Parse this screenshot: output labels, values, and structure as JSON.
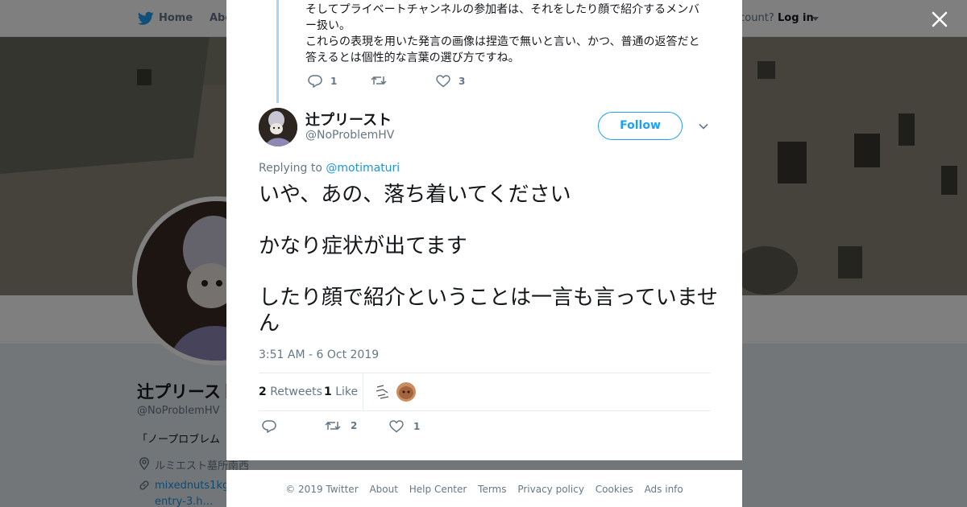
{
  "nav": {
    "home_label": "Home",
    "about_label": "Abo",
    "account_prompt": "ccount?",
    "login_label": "Log in"
  },
  "profile": {
    "name": "辻プリースト",
    "handle": "@NoProblemHV",
    "bio_fragment": "「ノープロブレム",
    "location": "ルミエスト墓所南西",
    "url_line1": "mixednuts1kg",
    "url_line2": "entry-3.h…"
  },
  "parent_tweet": {
    "lines": [
      "そしてプライベートチャンネルの参加者は、それをしたり顔で紹介するメンバ",
      "ー扱い。",
      "これらの表現を用いた発言の画像は捏造で無いと言い、かつ、普通の返答だと",
      "答えるとは個性的な言葉の選び方ですね。"
    ],
    "reply_count": "1",
    "retweet_count": "",
    "like_count": "3"
  },
  "tweet": {
    "author_name": "辻プリースト",
    "author_handle": "@NoProblemHV",
    "follow_label": "Follow",
    "replying_prefix": "Replying to",
    "replying_mention": "@motimaturi",
    "text_paragraphs": [
      "いや、あの、落ち着いてください",
      "かなり症状が出てます",
      "したり顔で紹介ということは一言も言っていません"
    ],
    "timestamp": "3:51 AM - 6 Oct 2019",
    "retweets_count": "2",
    "retweets_label": "Retweets",
    "likes_count": "1",
    "likes_label": "Like",
    "action_retweet_count": "2",
    "action_like_count": "1"
  },
  "footer": {
    "links": [
      "© 2019 Twitter",
      "About",
      "Help Center",
      "Terms",
      "Privacy policy",
      "Cookies",
      "Ads info"
    ]
  },
  "colors": {
    "accent": "#1da1f2",
    "link": "#1b95e0",
    "muted": "#657786",
    "text": "#14171a",
    "thread_line": "#a8d5f6"
  }
}
